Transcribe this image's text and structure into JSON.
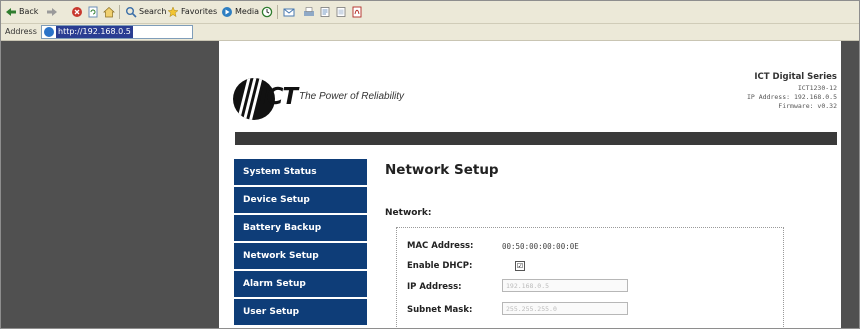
{
  "toolbar": {
    "back": "Back",
    "search": "Search",
    "favorites": "Favorites",
    "media": "Media"
  },
  "address": {
    "label": "Address",
    "url": "http://192.168.0.5"
  },
  "header": {
    "brand": "ICT",
    "tagline": "The Power of Reliability",
    "series": "ICT Digital Series",
    "model": "ICT1230-12",
    "ip_line": "IP Address: 192.168.0.5",
    "firmware_line": "Firmware: v0.32"
  },
  "nav": {
    "items": [
      {
        "label": "System Status"
      },
      {
        "label": "Device Setup"
      },
      {
        "label": "Battery Backup"
      },
      {
        "label": "Network Setup"
      },
      {
        "label": "Alarm Setup"
      },
      {
        "label": "User Setup"
      }
    ]
  },
  "main": {
    "title": "Network Setup",
    "section": "Network:",
    "fields": {
      "mac_label": "MAC Address:",
      "mac_value": "00:50:00:00:00:0E",
      "dhcp_label": "Enable DHCP:",
      "dhcp_checked": "☑",
      "ip_label": "IP Address:",
      "ip_value": "192.168.0.5",
      "subnet_label": "Subnet Mask:",
      "subnet_value": "255.255.255.0"
    }
  }
}
